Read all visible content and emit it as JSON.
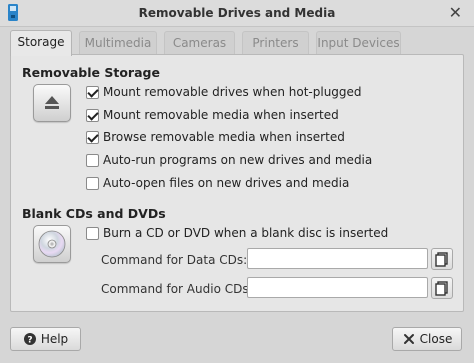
{
  "window": {
    "title": "Removable Drives and Media"
  },
  "tabs": [
    {
      "label": "Storage",
      "active": true
    },
    {
      "label": "Multimedia",
      "active": false
    },
    {
      "label": "Cameras",
      "active": false
    },
    {
      "label": "Printers",
      "active": false
    },
    {
      "label": "Input Devices",
      "active": false
    }
  ],
  "removable_storage": {
    "heading": "Removable Storage",
    "options": [
      {
        "label": "Mount removable drives when hot-plugged",
        "checked": true
      },
      {
        "label": "Mount removable media when inserted",
        "checked": true
      },
      {
        "label": "Browse removable media when inserted",
        "checked": true
      },
      {
        "label": "Auto-run programs on new drives and media",
        "checked": false
      },
      {
        "label": "Auto-open files on new drives and media",
        "checked": false
      }
    ]
  },
  "blank_discs": {
    "heading": "Blank CDs and DVDs",
    "burn_option": {
      "label": "Burn a CD or DVD when a blank disc is inserted",
      "checked": false
    },
    "data_cd": {
      "label": "Command for Data CDs:",
      "value": ""
    },
    "audio_cd": {
      "label": "Command for Audio CDs:",
      "value": ""
    }
  },
  "footer": {
    "help_label": "Help",
    "close_label": "Close"
  },
  "icons": {
    "eject": "eject-icon",
    "disc": "disc-icon",
    "browse": "browse-icon",
    "help": "help-icon",
    "close": "close-icon"
  },
  "colors": {
    "window_bg": "#d6d6d6",
    "panel_bg": "#e6e6e6",
    "app_icon": "#2a84c9"
  }
}
